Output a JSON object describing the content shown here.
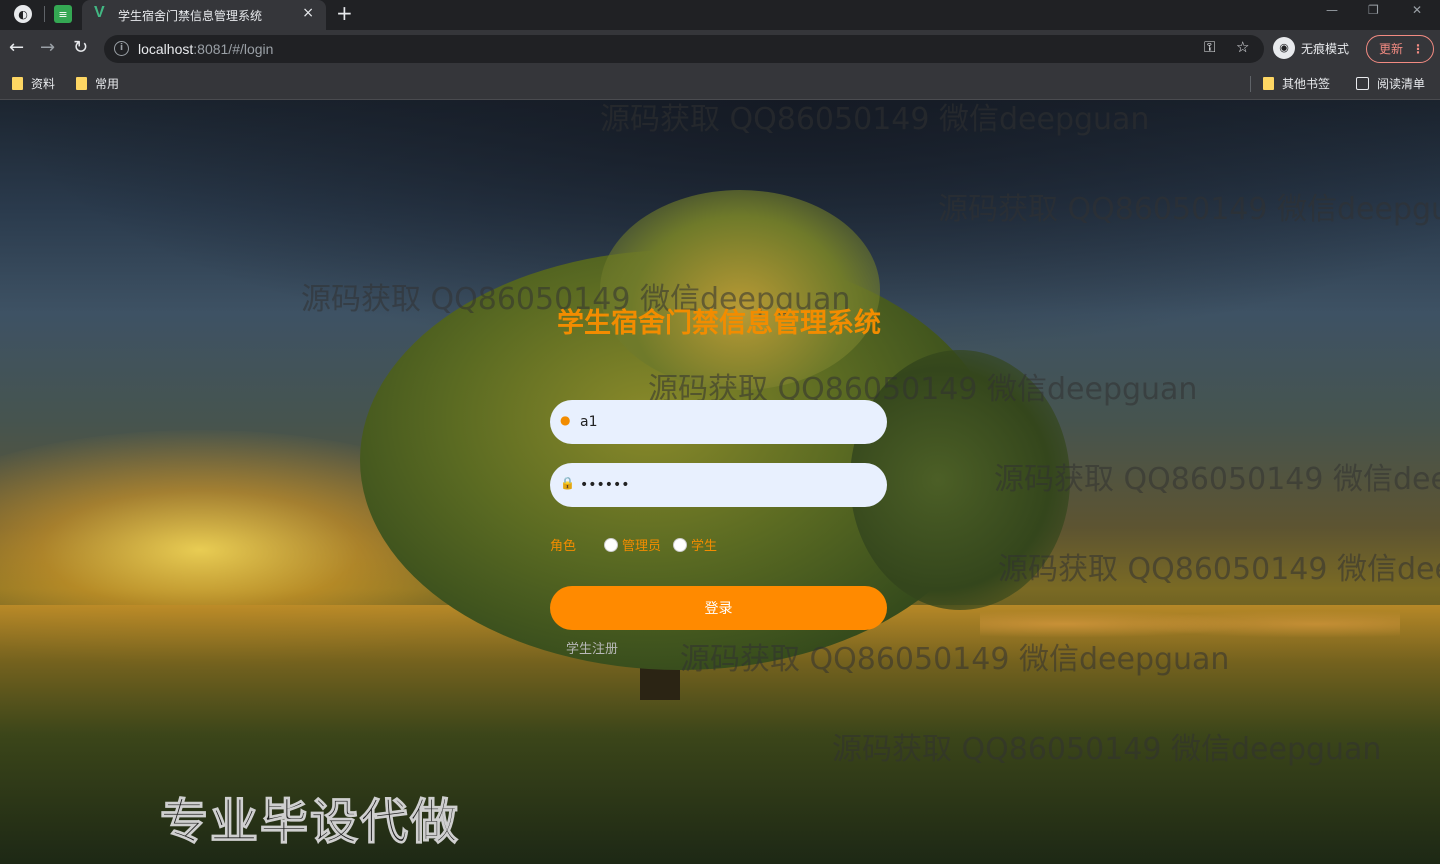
{
  "browser": {
    "tab": {
      "title": "学生宿舍门禁信息管理系统",
      "close": "×"
    },
    "new_tab": "+",
    "url_host": "localhost",
    "url_rest": ":8081/#/login",
    "incognito_label": "无痕模式",
    "update_label": "更新",
    "bookmarks": [
      {
        "label": "资料"
      },
      {
        "label": "常用"
      }
    ],
    "other_bookmarks": "其他书签",
    "reading_list": "阅读清单"
  },
  "login": {
    "title": "学生宿舍门禁信息管理系统",
    "username_value": "a1",
    "password_value": "123456",
    "role_label": "角色",
    "roles": [
      "管理员",
      "学生"
    ],
    "login_button": "登录",
    "register_link": "学生注册"
  },
  "watermark_text": "源码获取 QQ86050149 微信deepguan",
  "corner_ad": "专业毕设代做",
  "colors": {
    "accent": "#ff8a00",
    "title": "#f28c00"
  }
}
